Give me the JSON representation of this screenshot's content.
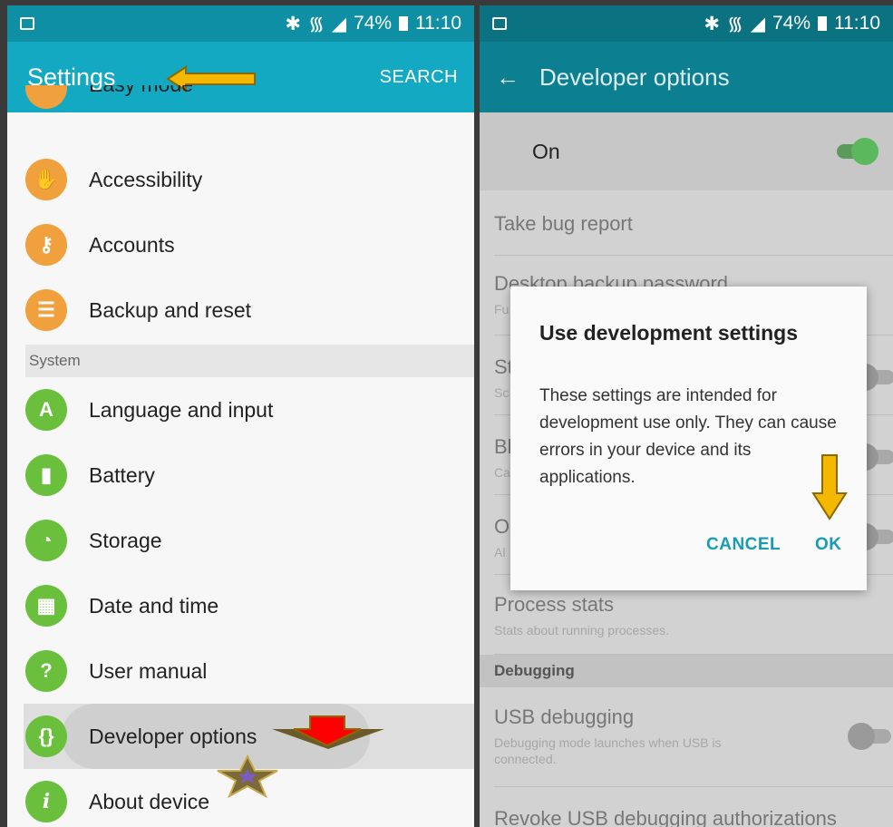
{
  "left_screen": {
    "status": {
      "percent": "74%",
      "time": "11:10"
    },
    "appbar": {
      "title": "Settings",
      "search": "SEARCH"
    },
    "partial_item": "Easy mode",
    "items_top": [
      {
        "label": "Accessibility",
        "icon": "hand-icon"
      },
      {
        "label": "Accounts",
        "icon": "key-icon"
      },
      {
        "label": "Backup and reset",
        "icon": "backup-icon"
      }
    ],
    "section_system": "System",
    "items_system": [
      {
        "label": "Language and input",
        "icon": "language-icon",
        "glyph": "A"
      },
      {
        "label": "Battery",
        "icon": "battery-icon",
        "glyph": "▮"
      },
      {
        "label": "Storage",
        "icon": "storage-icon",
        "glyph": "◔"
      },
      {
        "label": "Date and time",
        "icon": "calendar-icon",
        "glyph": "▦"
      },
      {
        "label": "User manual",
        "icon": "manual-icon",
        "glyph": "?"
      },
      {
        "label": "Developer options",
        "icon": "braces-icon",
        "glyph": "{}"
      },
      {
        "label": "About device",
        "icon": "info-icon",
        "glyph": "i"
      }
    ]
  },
  "right_screen": {
    "status": {
      "percent": "74%",
      "time": "11:10"
    },
    "appbar": {
      "title": "Developer options"
    },
    "on_label": "On",
    "items": [
      {
        "title": "Take bug report",
        "sub": ""
      },
      {
        "title": "Desktop backup password",
        "sub": "Fu"
      },
      {
        "title": "St",
        "sub": "Sc"
      },
      {
        "title": "Bl",
        "sub": "Ca"
      },
      {
        "title": "O",
        "sub": "Al"
      },
      {
        "title": "Process stats",
        "sub": "Stats about running processes."
      }
    ],
    "section_debugging": "Debugging",
    "usb_debugging": {
      "title": "USB debugging",
      "sub": "Debugging mode launches when USB is connected."
    },
    "revoke": "Revoke USB debugging authorizations",
    "dialog": {
      "title": "Use development settings",
      "body": "These settings are intended for development use only. They can cause errors in your device and its applications.",
      "cancel": "CANCEL",
      "ok": "OK"
    }
  },
  "colors": {
    "status_bar": "#0e8fa3",
    "app_bar": "#14a9c2",
    "icon_orange": "#f0a03c",
    "icon_green": "#6abf3c",
    "accent_button": "#1a9bb5",
    "annotation_yellow": "#f5b800",
    "annotation_red": "#ff0000"
  }
}
